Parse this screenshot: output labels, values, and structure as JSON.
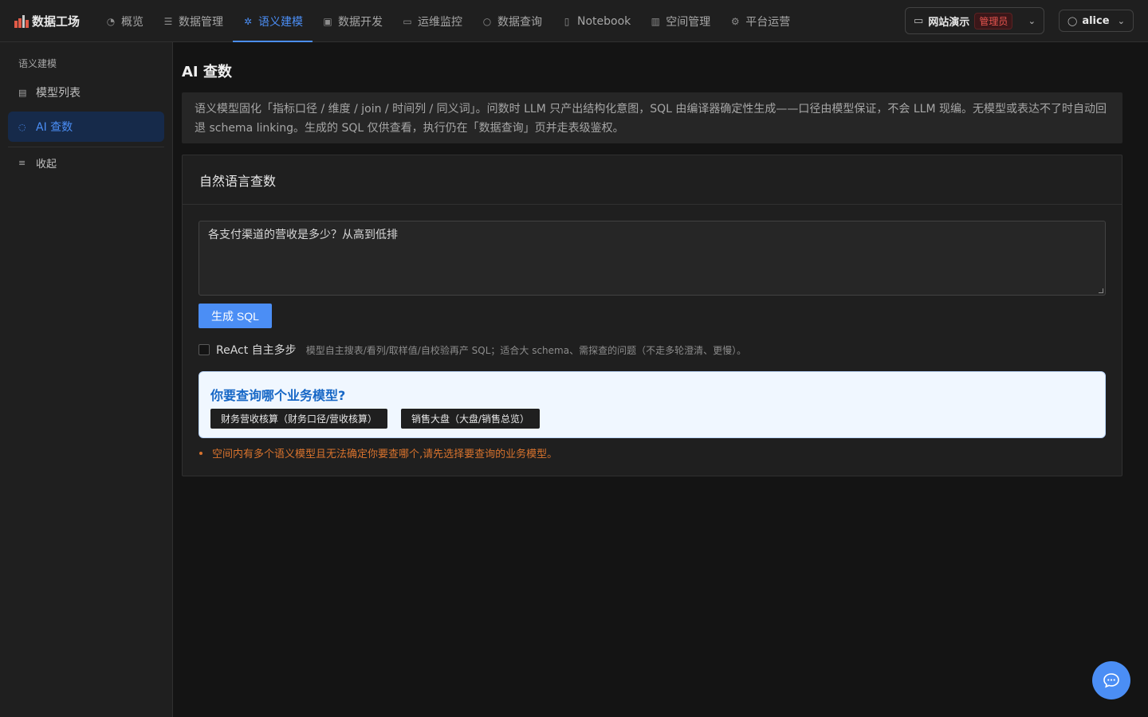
{
  "header": {
    "brand": "数据工场",
    "nav": [
      {
        "label": "概览",
        "icon": "dashboard-icon"
      },
      {
        "label": "数据管理",
        "icon": "database-icon"
      },
      {
        "label": "语义建模",
        "icon": "sparkle-icon"
      },
      {
        "label": "数据开发",
        "icon": "code-icon"
      },
      {
        "label": "运维监控",
        "icon": "monitor-icon"
      },
      {
        "label": "数据查询",
        "icon": "search-icon"
      },
      {
        "label": "Notebook",
        "icon": "book-icon"
      },
      {
        "label": "空间管理",
        "icon": "building-icon"
      },
      {
        "label": "平台运营",
        "icon": "gear-icon"
      }
    ],
    "active_nav": "语义建模",
    "workspace": {
      "name": "网站演示",
      "role": "管理员"
    },
    "user": "alice",
    "accent_color": "#4b8ef5"
  },
  "sidebar": {
    "group_title": "语义建模",
    "items": [
      {
        "label": "模型列表",
        "icon": "list-icon"
      },
      {
        "label": "AI 查数",
        "icon": "chat-icon"
      }
    ],
    "collapse_label": "收起"
  },
  "main": {
    "title": "AI 查数",
    "notice": "语义模型固化「指标口径 / 维度 / join / 时间列 / 同义词」。问数时 LLM 只产出结构化意图，SQL 由编译器确定性生成——口径由模型保证，不会 LLM 现编。无模型或表达不了时自动回退 schema linking。生成的 SQL 仅供查看，执行仍在「数据查询」页并走表级鉴权。",
    "card_title": "自然语言查数",
    "query_value": "各支付渠道的营收是多少？从高到低排",
    "generate_button": "生成 SQL",
    "react_label": "ReAct 自主多步",
    "react_hint": "模型自主搜表/看列/取样值/自校验再产 SQL；适合大 schema、需探查的问题（不走多轮澄清、更慢）。",
    "model_question": "你要查询哪个业务模型?",
    "model_options": [
      "财务营收核算（财务口径/营收核算）",
      "销售大盘（大盘/销售总览）"
    ],
    "warning": "空间内有多个语义模型且无法确定你要查哪个,请先选择要查询的业务模型。"
  }
}
